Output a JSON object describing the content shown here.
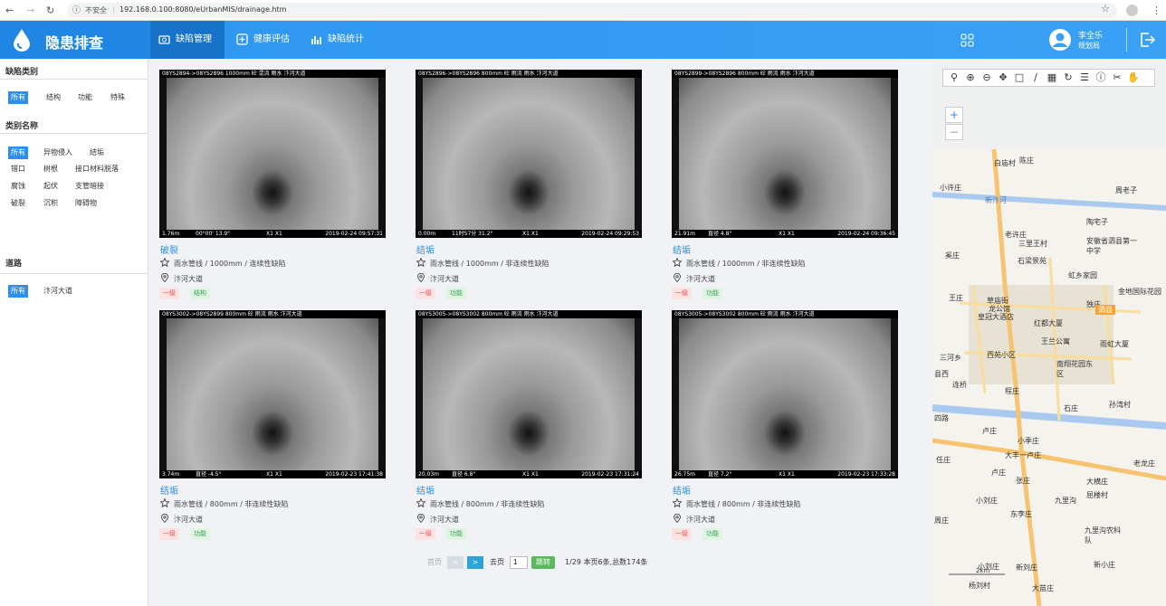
{
  "browser": {
    "insecure_label": "不安全",
    "url": "192.168.0.100:8080/eUrbanMIS/drainage.htm"
  },
  "header": {
    "app_title": "隐患排查",
    "nav": [
      {
        "label": "缺陷管理",
        "active": true
      },
      {
        "label": "健康评估",
        "active": false
      },
      {
        "label": "缺陷统计",
        "active": false
      }
    ],
    "user_name": "李全乐",
    "user_org": "规划局"
  },
  "sidebar": {
    "defect_type_heading": "缺陷类别",
    "defect_types": [
      "所有",
      "结构",
      "功能",
      "特殊"
    ],
    "category_heading": "类别名称",
    "categories": [
      "所有",
      "异物侵入",
      "结垢",
      "错口",
      "树根",
      "接口材料脱落",
      "腐蚀",
      "起伏",
      "支管暗接",
      "破裂",
      "沉积",
      "障碍物"
    ],
    "road_heading": "道路",
    "roads": [
      "所有",
      "汴河大道"
    ]
  },
  "cards": [
    {
      "overlay_top": "08YS2894->08YS2896 1000mm 砼 混流 雨水 汴河大道",
      "overlay_dist": "1.76m",
      "overlay_angle": "00°00' 13.9°",
      "overlay_x": "X1 X1",
      "overlay_time": "2019-02-24 09:57:31",
      "title": "破裂",
      "desc": "雨水管线 / 1000mm / 连续性缺陷",
      "road": "汴河大道",
      "level": "一级",
      "type": "结构"
    },
    {
      "overlay_top": "08YS2896->08YS2896 800mm 砼 雨流 雨水 汴河大道",
      "overlay_dist": "0.00m",
      "overlay_angle": "11时57分 31.2°",
      "overlay_x": "X1 X1",
      "overlay_time": "2019-02-24 09:29:53",
      "title": "结垢",
      "desc": "雨水管线 / 1000mm / 非连续性缺陷",
      "road": "汴河大道",
      "level": "一级",
      "type": "功能"
    },
    {
      "overlay_top": "08YS2899->08YS2896 800mm 砼 雨流 雨水 汴河大道",
      "overlay_dist": "21.91m",
      "overlay_angle": "直径 4.8°",
      "overlay_x": "X1 X1",
      "overlay_time": "2019-02-24 09:36:45",
      "title": "结垢",
      "desc": "雨水管线 / 1000mm / 非连续性缺陷",
      "road": "汴河大道",
      "level": "一级",
      "type": "功能"
    },
    {
      "overlay_top": "08YS3002->08YS2899 800mm 砼 雨流 雨水 汴河大道",
      "overlay_dist": "3.74m",
      "overlay_angle": "直径 -4.5°",
      "overlay_x": "X1 X1",
      "overlay_time": "2019-02-23 17:41:38",
      "title": "结垢",
      "desc": "雨水管线 / 800mm / 非连续性缺陷",
      "road": "汴河大道",
      "level": "一级",
      "type": "功能"
    },
    {
      "overlay_top": "08YS3005->08YS3002 800mm 砼 雨流 雨水 汴河大道",
      "overlay_dist": "20.03m",
      "overlay_angle": "直径 6.8°",
      "overlay_x": "X1 X1",
      "overlay_time": "2019-02-23 17:31:24",
      "title": "结垢",
      "desc": "雨水管线 / 800mm / 非连续性缺陷",
      "road": "汴河大道",
      "level": "一级",
      "type": "功能"
    },
    {
      "overlay_top": "08YS3005->08YS3002 800mm 砼 雨流 雨水 汴河大道",
      "overlay_dist": "26.75m",
      "overlay_angle": "直径 7.2°",
      "overlay_x": "X1 X1",
      "overlay_time": "2019-02-23 17:33:28",
      "title": "结垢",
      "desc": "雨水管线 / 800mm / 非连续性缺陷",
      "road": "汴河大道",
      "level": "一级",
      "type": "功能"
    }
  ],
  "pager": {
    "first": "首页",
    "prev": "<",
    "next": ">",
    "goto_label": "去页",
    "page_input": "1",
    "jump": "跳转",
    "summary": "1/29 本页6条,总数174条"
  },
  "map": {
    "zoom_in": "+",
    "zoom_out": "−",
    "scale": "2km",
    "labels": [
      "白庙村",
      "陈庄",
      "小许庄",
      "周老子",
      "陶宅子",
      "老许庄",
      "三里王村",
      "安徽省泗县第一中学",
      "奚庄",
      "石梁景苑",
      "虹乡家园",
      "王庄",
      "草庙街",
      "龙公馆",
      "皇冠大酒店",
      "独庄",
      "金地国际花园",
      "红都大厦",
      "泗县",
      "王兰公寓",
      "雨虹大厦",
      "西苑小区",
      "三河乡",
      "南翔花园东区",
      "县西",
      "连桥",
      "程庄",
      "石庄",
      "孙湾村",
      "四路",
      "卢庄",
      "小季庄",
      "任庄",
      "卢庄",
      "张庄",
      "大横庄",
      "屈楼村",
      "小刘庄",
      "九里沟",
      "东李庄",
      "周庄",
      "九里沟农科队",
      "小刘庄",
      "新刘庄",
      "新小庄",
      "杨刘村",
      "大苗庄",
      "老龙庄",
      "新汴河",
      "大丰一卢庄"
    ]
  }
}
